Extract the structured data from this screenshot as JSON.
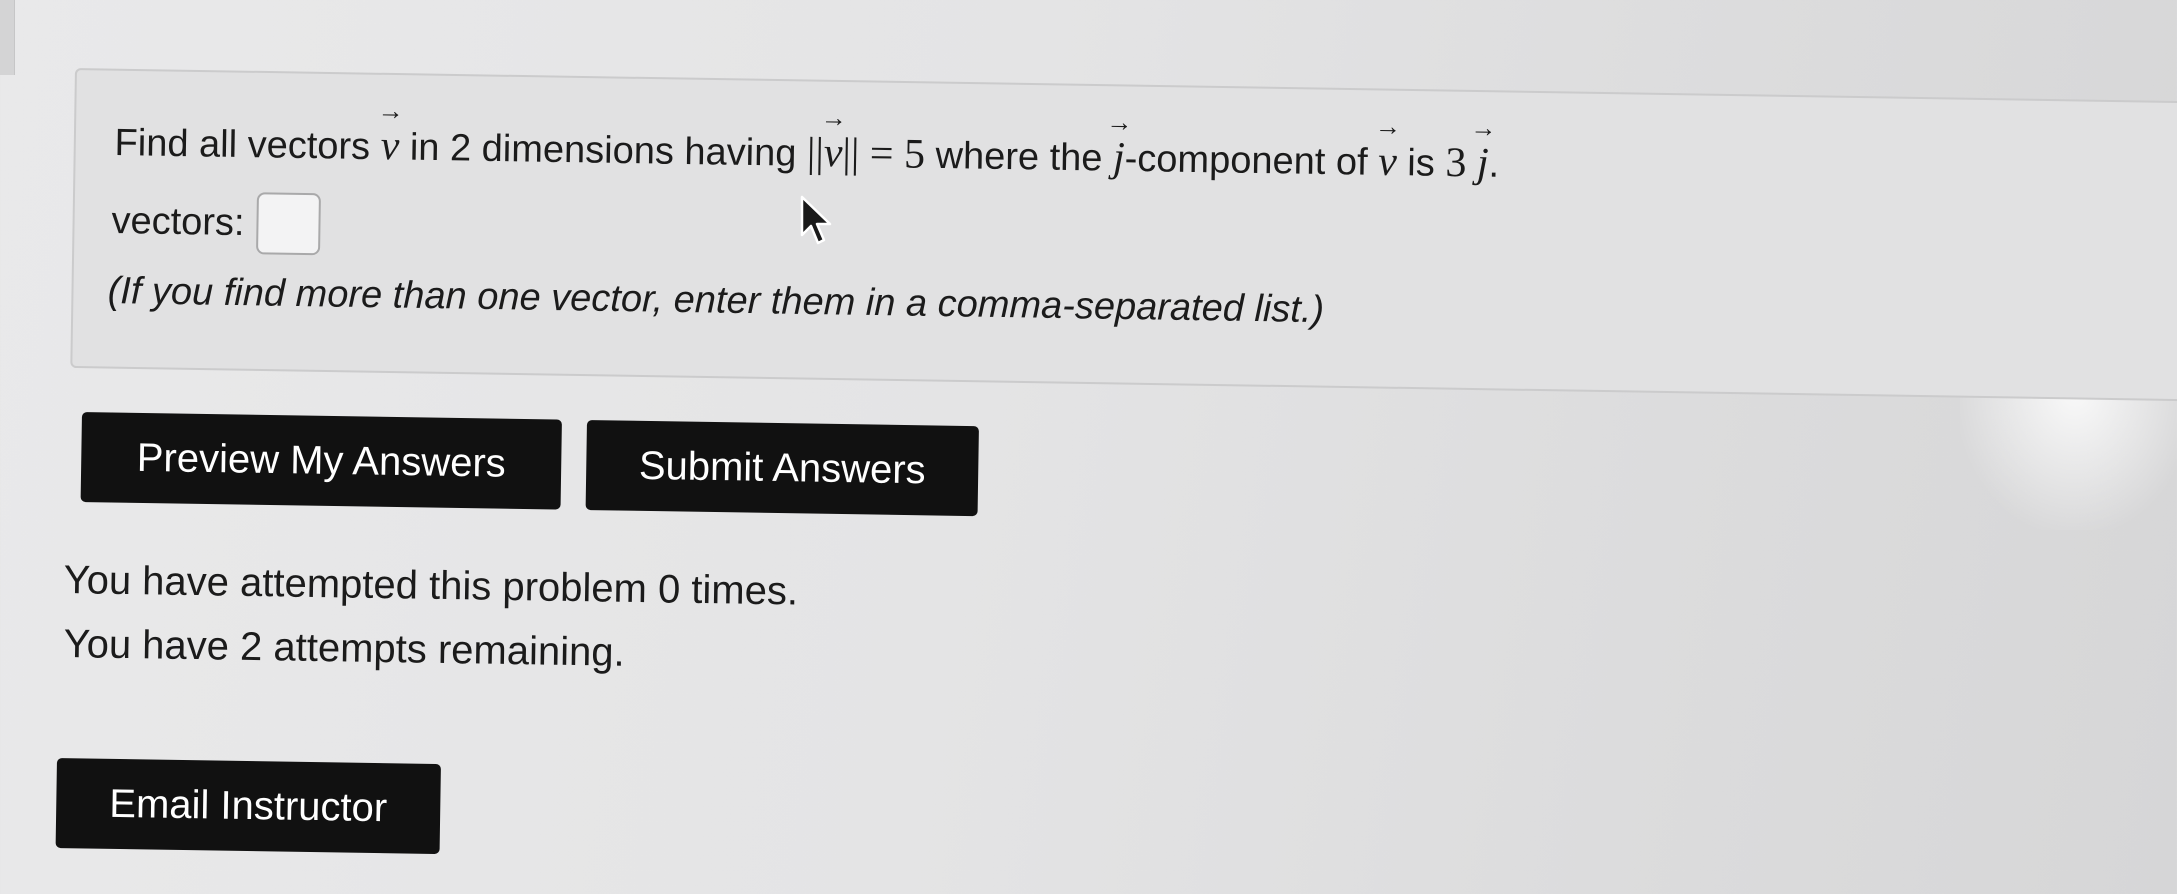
{
  "problem": {
    "text_find_all": "Find all vectors",
    "var_v": "v",
    "text_in_2_dim": "in 2 dimensions having",
    "norm_open": "||",
    "norm_close": "||",
    "equals_five": "= 5",
    "text_where_the": "where the",
    "var_j": "j",
    "text_component_of": "-component of",
    "text_is": "is",
    "coef_three": "3",
    "period": "."
  },
  "answer": {
    "label": "vectors:",
    "value": ""
  },
  "hint_text": "(If you find more than one vector, enter them in a comma-separated list.)",
  "buttons": {
    "preview": "Preview My Answers",
    "submit": "Submit Answers",
    "email": "Email Instructor"
  },
  "status": {
    "attempted": "You have attempted this problem 0 times.",
    "remaining": "You have 2 attempts remaining."
  },
  "icons": {
    "cursor": "mouse-pointer-icon"
  }
}
